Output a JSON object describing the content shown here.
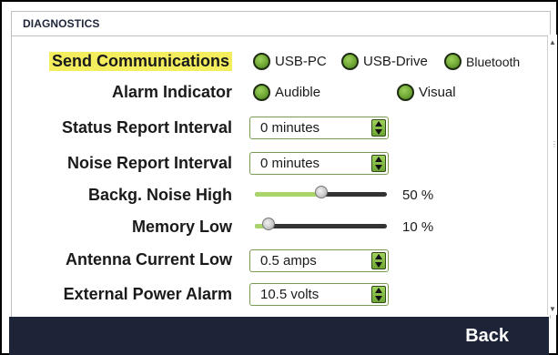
{
  "title": "DIAGNOSTICS",
  "rows": {
    "send_communications": {
      "label": "Send Communications",
      "options": [
        "USB-PC",
        "USB-Drive",
        "Bluetooth"
      ]
    },
    "alarm_indicator": {
      "label": "Alarm Indicator",
      "options": [
        "Audible",
        "Visual"
      ]
    },
    "status_report_interval": {
      "label": "Status Report Interval",
      "value": "0 minutes"
    },
    "noise_report_interval": {
      "label": "Noise Report Interval",
      "value": "0 minutes"
    },
    "backg_noise_high": {
      "label": "Backg. Noise High",
      "value_text": "50 %",
      "level": 0.5
    },
    "memory_low": {
      "label": "Memory Low",
      "value_text": "10 %",
      "level": 0.1
    },
    "antenna_current_low": {
      "label": "Antenna Current Low",
      "value": "0.5 amps"
    },
    "external_power_alarm": {
      "label": "External Power Alarm",
      "value": "10.5 volts"
    }
  },
  "footer": {
    "back_label": "Back"
  },
  "colors": {
    "accent_green": "#6fa735",
    "highlight_yellow": "#f4ee5f",
    "footer_navy": "#1d2438"
  }
}
